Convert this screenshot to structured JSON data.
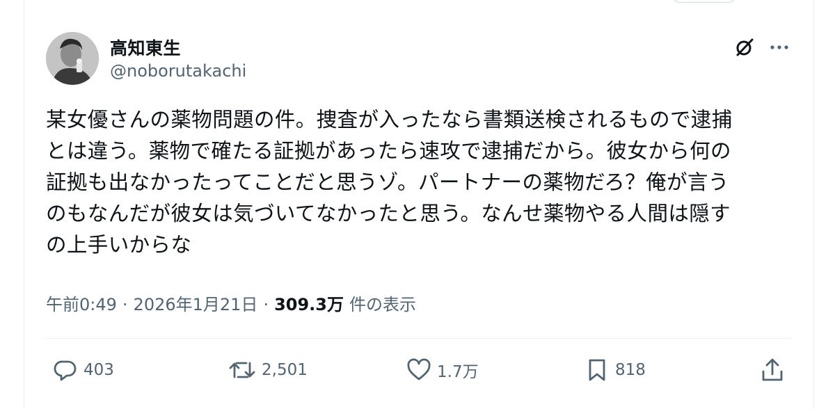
{
  "author": {
    "display_name": "高知東生",
    "handle": "@noborutakachi"
  },
  "tweet": {
    "text": "某女優さんの薬物問題の件。捜査が入ったなら書類送検されるもので逮捕\nとは違う。薬物で確たる証拠があったら速攻で逮捕だから。彼女から何の\n証拠も出なかったってことだと思うゾ。パートナーの薬物だろ？俺が言う\nのもなんだが彼女は気づいてなかったと思う。なんせ薬物やる人間は隠す\nの上手いからな"
  },
  "meta": {
    "time": "午前0:49",
    "separator": "·",
    "date": "2026年1月21日",
    "views_count": "309.3万",
    "views_label": "件の表示"
  },
  "actions": {
    "reply": {
      "icon": "reply-icon",
      "count": "403"
    },
    "retweet": {
      "icon": "retweet-icon",
      "count": "2,501"
    },
    "like": {
      "icon": "heart-icon",
      "count": "1.7万"
    },
    "bookmark": {
      "icon": "bookmark-icon",
      "count": "818"
    },
    "share": {
      "icon": "share-icon"
    }
  },
  "header_icons": [
    "grok-icon",
    "more-icon"
  ],
  "colors": {
    "text_primary": "#0f1419",
    "text_secondary": "#536471",
    "border": "#eff3f4"
  }
}
